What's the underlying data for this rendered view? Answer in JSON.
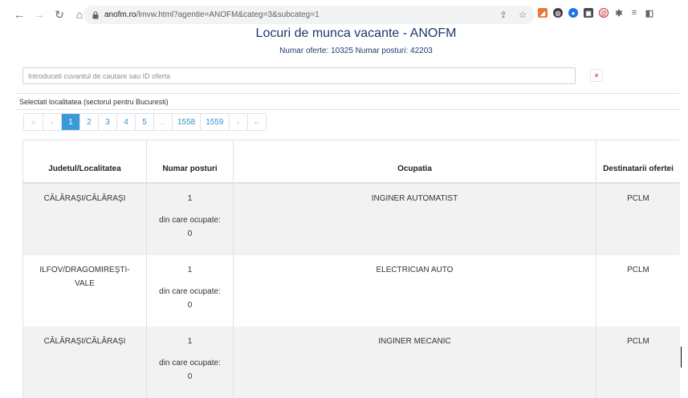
{
  "browser": {
    "url_domain": "anofm.ro",
    "url_path": "/lmvw.html?agentie=ANOFM&categ=3&subcateg=1"
  },
  "header": {
    "title": "Locuri de munca vacante - ANOFM",
    "subtitle": "Numar oferte: 10325 Numar posturi: 42203"
  },
  "search": {
    "placeholder": "Introduceti cuvantul de cautare sau ID oferta",
    "clear_label": "×"
  },
  "filter": {
    "locality_label": "Selectati localitatea (sectorul pentru Bucuresti)"
  },
  "pagination": {
    "first": "‹‹",
    "prev": "‹",
    "pages": [
      "1",
      "2",
      "3",
      "4",
      "5",
      "...",
      "1558",
      "1559"
    ],
    "next": "›",
    "last": "››",
    "active_page": "1"
  },
  "table": {
    "columns": [
      "Judetul/Localitatea",
      "Numar posturi",
      "Ocupatia",
      "Destinatarii ofertei"
    ],
    "rows": [
      {
        "location": "CĂLĂRAŞI/CĂLĂRAŞI",
        "posts": "1",
        "occupied_label": "din care ocupate:",
        "occupied": "0",
        "occupation": "INGINER AUTOMATIST",
        "recipient": "PCLM"
      },
      {
        "location": "ILFOV/DRAGOMIREŞTI-VALE",
        "posts": "1",
        "occupied_label": "din care ocupate:",
        "occupied": "0",
        "occupation": "ELECTRICIAN AUTO",
        "recipient": "PCLM"
      },
      {
        "location": "CĂLĂRAŞI/CĂLĂRAŞI",
        "posts": "1",
        "occupied_label": "din care ocupate:",
        "occupied": "0",
        "occupation": "INGINER MECANIC",
        "recipient": "PCLM"
      }
    ]
  }
}
